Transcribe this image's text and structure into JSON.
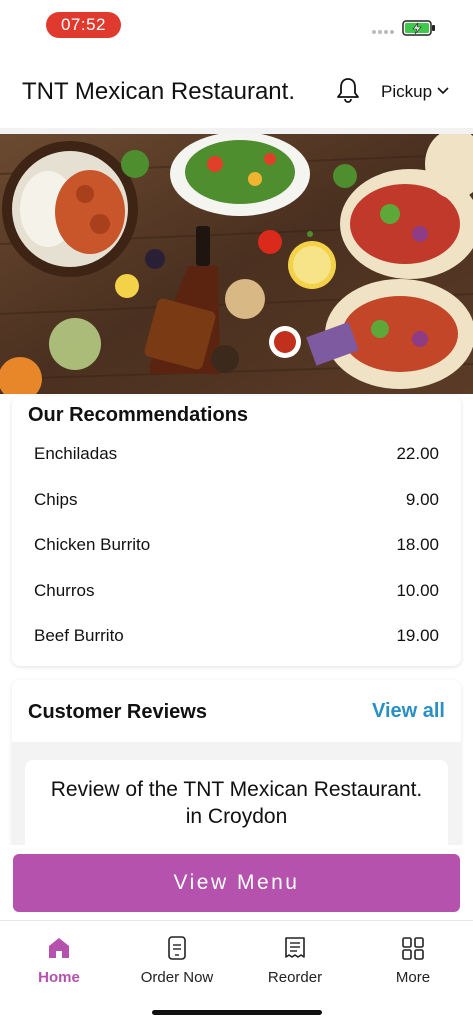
{
  "status_bar": {
    "time": "07:52",
    "time_pill_color": "#e03a2f",
    "battery_icon": "battery-charging-icon"
  },
  "header": {
    "title": "TNT Mexican Restaurant.",
    "notification_icon": "bell-icon",
    "mode_label": "Pickup",
    "mode_icon": "chevron-down-icon"
  },
  "hero": {
    "image": "mexican-food-table-photo"
  },
  "recommendations": {
    "title": "Our Recommendations",
    "items": [
      {
        "name": "Enchiladas",
        "price": "22.00"
      },
      {
        "name": "Chips",
        "price": "9.00"
      },
      {
        "name": "Chicken Burrito",
        "price": "18.00"
      },
      {
        "name": "Churros",
        "price": "10.00"
      },
      {
        "name": "Beef Burrito",
        "price": "19.00"
      }
    ]
  },
  "reviews": {
    "title": "Customer Reviews",
    "view_all_label": "View all",
    "view_all_color": "#2a8fc2",
    "review_heading": "Review of the TNT Mexican Restaurant. in Croydon"
  },
  "cta": {
    "label": "View Menu",
    "color": "#b452ad"
  },
  "tabs": [
    {
      "label": "Home",
      "icon": "home-icon",
      "active": true
    },
    {
      "label": "Order Now",
      "icon": "phone-order-icon",
      "active": false
    },
    {
      "label": "Reorder",
      "icon": "receipt-icon",
      "active": false
    },
    {
      "label": "More",
      "icon": "grid-icon",
      "active": false
    }
  ]
}
